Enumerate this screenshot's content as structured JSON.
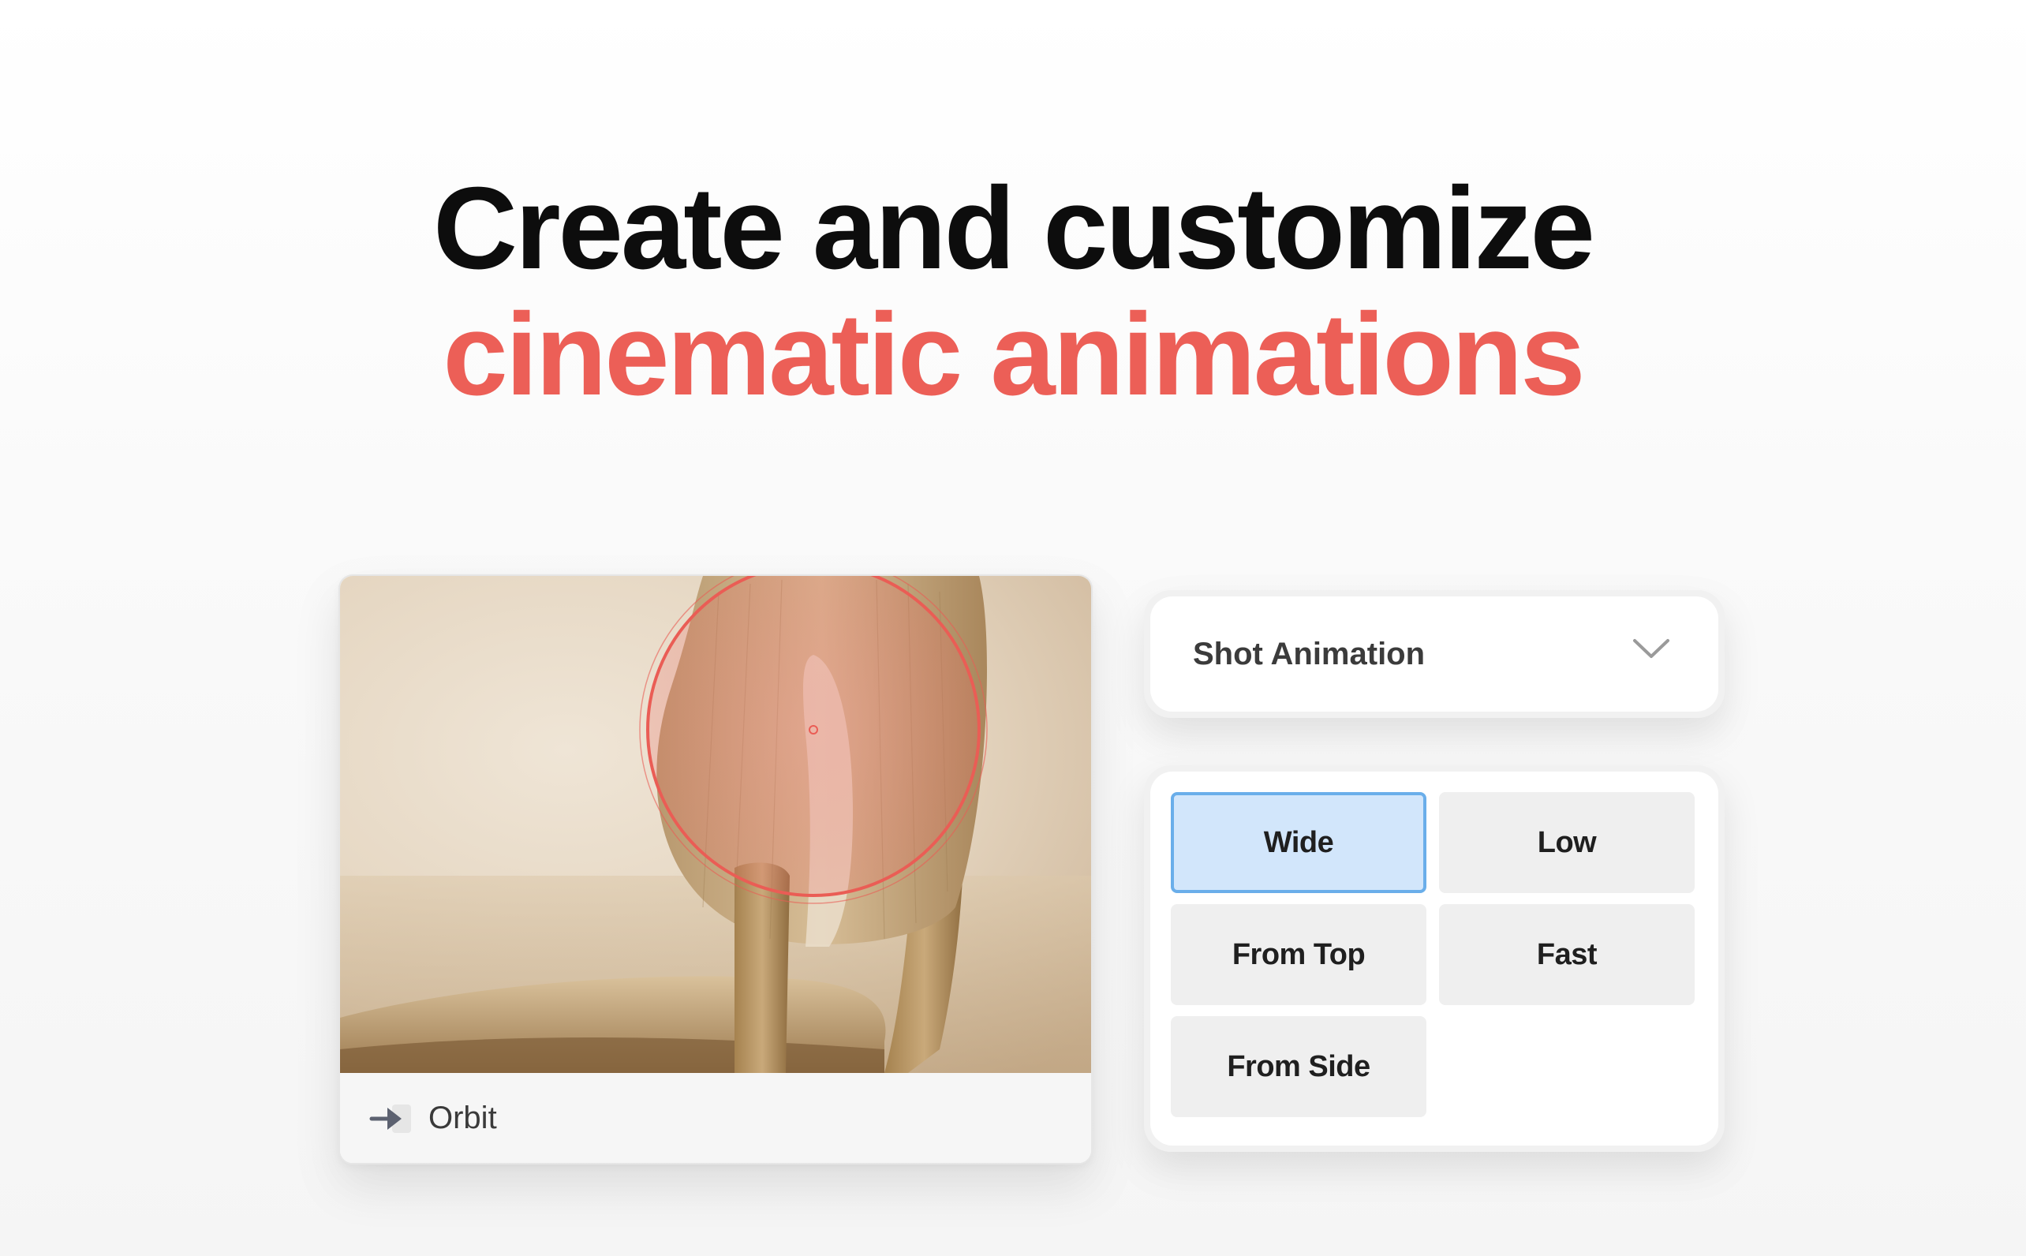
{
  "headline": {
    "line1": "Create and customize",
    "line2": "cinematic animations"
  },
  "preview": {
    "label": "Orbit",
    "icon": "arrow-right-icon"
  },
  "dropdown": {
    "label": "Shot Animation",
    "icon": "chevron-down-icon"
  },
  "options": [
    {
      "label": "Wide",
      "selected": true
    },
    {
      "label": "Low",
      "selected": false
    },
    {
      "label": "From Top",
      "selected": false
    },
    {
      "label": "Fast",
      "selected": false
    },
    {
      "label": "From Side",
      "selected": false
    }
  ],
  "colors": {
    "accent": "#ec5f57",
    "selected_fill": "#d2e6fb",
    "selected_border": "#6aaeea",
    "option_fill": "#efefef"
  }
}
